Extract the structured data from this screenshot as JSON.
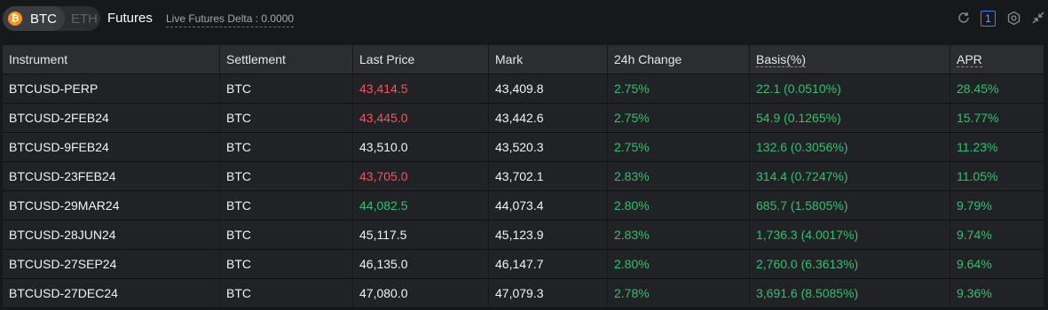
{
  "topbar": {
    "coin_icon": "₿",
    "coin_btc": "BTC",
    "coin_eth": "ETH",
    "section": "Futures",
    "delta_label": "Live Futures Delta : 0.0000",
    "badge": "1"
  },
  "icons": {
    "refresh": "refresh-icon",
    "settings": "settings-icon",
    "collapse": "collapse-icon"
  },
  "table": {
    "headers": [
      "Instrument",
      "Settlement",
      "Last Price",
      "Mark",
      "24h Change",
      "Basis(%)",
      "APR"
    ],
    "rows": [
      {
        "instrument": "BTCUSD-PERP",
        "settlement": "BTC",
        "last_price": "43,414.5",
        "last_color": "red",
        "mark": "43,409.8",
        "change": "2.75%",
        "basis": "22.1 (0.0510%)",
        "apr": "28.45%"
      },
      {
        "instrument": "BTCUSD-2FEB24",
        "settlement": "BTC",
        "last_price": "43,445.0",
        "last_color": "red",
        "mark": "43,442.6",
        "change": "2.75%",
        "basis": "54.9 (0.1265%)",
        "apr": "15.77%"
      },
      {
        "instrument": "BTCUSD-9FEB24",
        "settlement": "BTC",
        "last_price": "43,510.0",
        "last_color": "white",
        "mark": "43,520.3",
        "change": "2.75%",
        "basis": "132.6 (0.3056%)",
        "apr": "11.23%"
      },
      {
        "instrument": "BTCUSD-23FEB24",
        "settlement": "BTC",
        "last_price": "43,705.0",
        "last_color": "red",
        "mark": "43,702.1",
        "change": "2.83%",
        "basis": "314.4 (0.7247%)",
        "apr": "11.05%"
      },
      {
        "instrument": "BTCUSD-29MAR24",
        "settlement": "BTC",
        "last_price": "44,082.5",
        "last_color": "green",
        "mark": "44,073.4",
        "change": "2.80%",
        "basis": "685.7 (1.5805%)",
        "apr": "9.79%"
      },
      {
        "instrument": "BTCUSD-28JUN24",
        "settlement": "BTC",
        "last_price": "45,117.5",
        "last_color": "white",
        "mark": "45,123.9",
        "change": "2.83%",
        "basis": "1,736.3 (4.0017%)",
        "apr": "9.74%"
      },
      {
        "instrument": "BTCUSD-27SEP24",
        "settlement": "BTC",
        "last_price": "46,135.0",
        "last_color": "white",
        "mark": "46,147.7",
        "change": "2.80%",
        "basis": "2,760.0 (6.3613%)",
        "apr": "9.64%"
      },
      {
        "instrument": "BTCUSD-27DEC24",
        "settlement": "BTC",
        "last_price": "47,080.0",
        "last_color": "white",
        "mark": "47,079.3",
        "change": "2.78%",
        "basis": "3,691.6 (8.5085%)",
        "apr": "9.36%"
      }
    ]
  },
  "colors": {
    "background": "#17181a",
    "row": "#212226",
    "header": "#2b2d30",
    "up": "#2fc26b",
    "down": "#f1555f",
    "btc_orange": "#f7931a",
    "accent_blue": "#3b82f6"
  }
}
